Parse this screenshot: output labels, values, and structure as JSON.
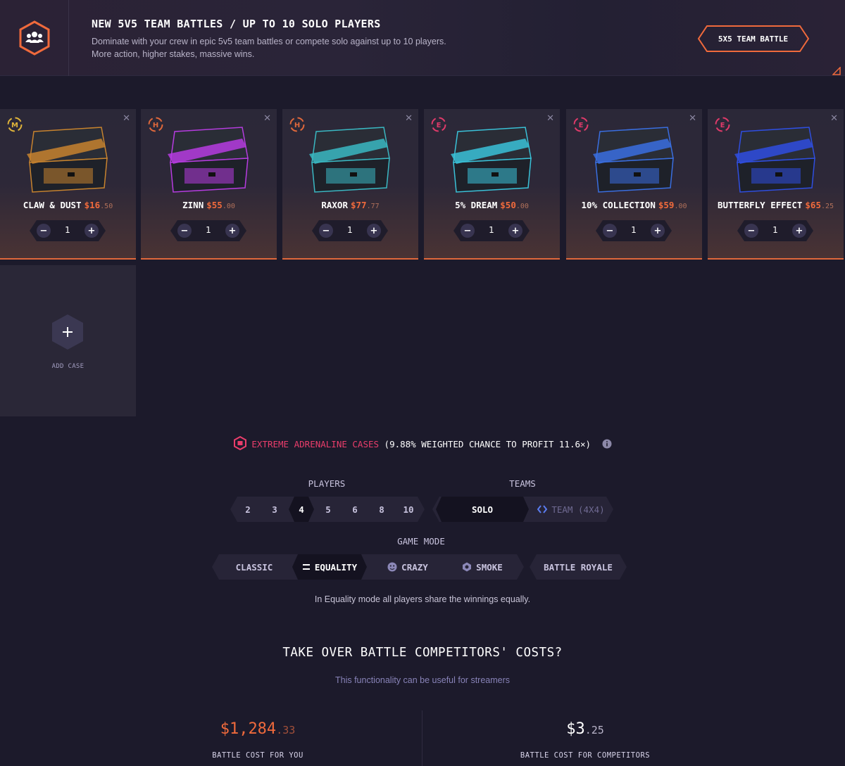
{
  "banner": {
    "title": "NEW 5V5 TEAM BATTLES / UP TO 10 SOLO PLAYERS",
    "line1": "Dominate with your crew in epic 5v5 team battles or compete solo against up to 10 players.",
    "line2": "More action, higher stakes, massive wins.",
    "button": "5X5 TEAM BATTLE",
    "icon": "team-users-icon"
  },
  "cases": [
    {
      "tier": "M",
      "tier_color": "#e0b43a",
      "name": "CLAW & DUST",
      "price": "$16",
      "cents": ".50",
      "qty": "1",
      "art_color": "#c7832e"
    },
    {
      "tier": "H",
      "tier_color": "#e0683b",
      "name": "ZINN",
      "price": "$55",
      "cents": ".00",
      "qty": "1",
      "art_color": "#b63ce0"
    },
    {
      "tier": "H",
      "tier_color": "#e0683b",
      "name": "RAXOR",
      "price": "$77",
      "cents": ".77",
      "qty": "1",
      "art_color": "#3ab8c2"
    },
    {
      "tier": "E",
      "tier_color": "#e03a6a",
      "name": "5% DREAM",
      "price": "$50",
      "cents": ".00",
      "qty": "1",
      "art_color": "#3ac2d8"
    },
    {
      "tier": "E",
      "tier_color": "#e03a6a",
      "name": "10% COLLECTION",
      "price": "$59",
      "cents": ".00",
      "qty": "1",
      "art_color": "#3a6ee0"
    },
    {
      "tier": "E",
      "tier_color": "#e03a6a",
      "name": "BUTTERFLY EFFECT",
      "price": "$65",
      "cents": ".25",
      "qty": "1",
      "art_color": "#2f4ee0"
    }
  ],
  "add_case": {
    "label": "ADD CASE"
  },
  "info": {
    "highlight": "EXTREME ADRENALINE CASES",
    "rest": " (9.88% WEIGHTED CHANCE TO PROFIT 11.6×)"
  },
  "players": {
    "label": "PLAYERS",
    "options": [
      "2",
      "3",
      "4",
      "5",
      "6",
      "8",
      "10"
    ],
    "selected": "4"
  },
  "teams": {
    "label": "TEAMS",
    "options": [
      "SOLO",
      "TEAM (4X4)"
    ],
    "selected": "SOLO"
  },
  "game_mode": {
    "label": "GAME MODE",
    "options": [
      "CLASSIC",
      "EQUALITY",
      "CRAZY",
      "SMOKE"
    ],
    "extra": "BATTLE ROYALE",
    "selected": "EQUALITY",
    "description": "In Equality mode all players share the winnings equally."
  },
  "takeover": {
    "title": "TAKE OVER BATTLE COMPETITORS' COSTS?",
    "subtitle": "This functionality can be useful for streamers"
  },
  "costs": {
    "you": {
      "amount": "$1,284",
      "cents": ".33",
      "label": "BATTLE COST FOR YOU",
      "color": "#f06a3c",
      "cents_color": "#a3503a"
    },
    "competitors": {
      "amount": "$3",
      "cents": ".25",
      "label": "BATTLE COST FOR COMPETITORS",
      "color": "#ffffff",
      "cents_color": "#b9b4c9"
    }
  },
  "colors": {
    "accent": "#f06a3c",
    "pink": "#ea3d6b",
    "bg": "#1c1a2b"
  }
}
